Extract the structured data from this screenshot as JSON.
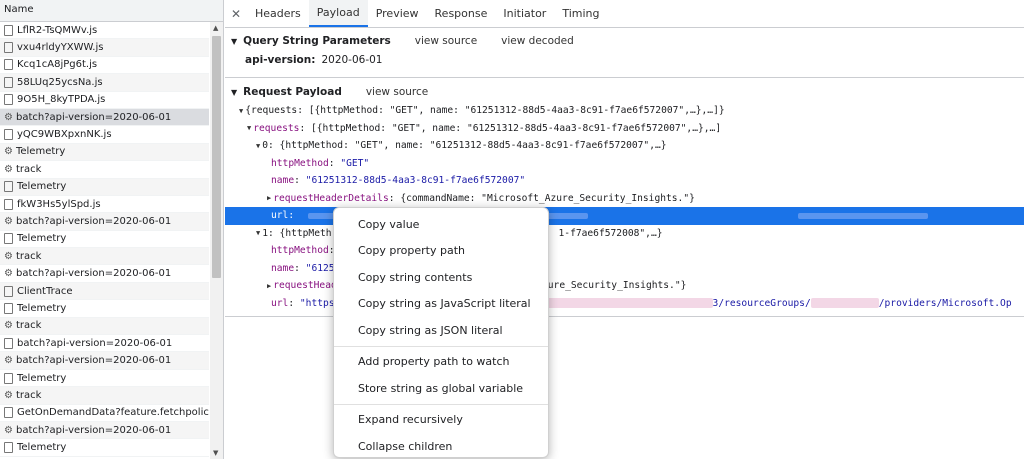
{
  "left": {
    "column_header": "Name",
    "rows": [
      {
        "icon": "file",
        "label": "LflR2-TsQMWv.js",
        "selected": false
      },
      {
        "icon": "file",
        "label": "vxu4rldyYXWW.js",
        "selected": false
      },
      {
        "icon": "file",
        "label": "Kcq1cA8jPg6t.js",
        "selected": false
      },
      {
        "icon": "file",
        "label": "58LUq25ycsNa.js",
        "selected": false
      },
      {
        "icon": "file",
        "label": "9O5H_8kyTPDA.js",
        "selected": false
      },
      {
        "icon": "gear",
        "label": "batch?api-version=2020-06-01",
        "selected": true
      },
      {
        "icon": "file",
        "label": "yQC9WBXpxnNK.js",
        "selected": false
      },
      {
        "icon": "gear",
        "label": "Telemetry",
        "selected": false
      },
      {
        "icon": "gear",
        "label": "track",
        "selected": false
      },
      {
        "icon": "file",
        "label": "Telemetry",
        "selected": false
      },
      {
        "icon": "file",
        "label": "fkW3Hs5ylSpd.js",
        "selected": false
      },
      {
        "icon": "gear",
        "label": "batch?api-version=2020-06-01",
        "selected": false
      },
      {
        "icon": "file",
        "label": "Telemetry",
        "selected": false
      },
      {
        "icon": "gear",
        "label": "track",
        "selected": false
      },
      {
        "icon": "gear",
        "label": "batch?api-version=2020-06-01",
        "selected": false
      },
      {
        "icon": "file",
        "label": "ClientTrace",
        "selected": false
      },
      {
        "icon": "file",
        "label": "Telemetry",
        "selected": false
      },
      {
        "icon": "gear",
        "label": "track",
        "selected": false
      },
      {
        "icon": "file",
        "label": "batch?api-version=2020-06-01",
        "selected": false
      },
      {
        "icon": "gear",
        "label": "batch?api-version=2020-06-01",
        "selected": false
      },
      {
        "icon": "file",
        "label": "Telemetry",
        "selected": false
      },
      {
        "icon": "gear",
        "label": "track",
        "selected": false
      },
      {
        "icon": "file",
        "label": "GetOnDemandData?feature.fetchpolicyforre",
        "selected": false
      },
      {
        "icon": "gear",
        "label": "batch?api-version=2020-06-01",
        "selected": false
      },
      {
        "icon": "file",
        "label": "Telemetry",
        "selected": false
      }
    ]
  },
  "tabs": {
    "close_symbol": "✕",
    "items": [
      "Headers",
      "Payload",
      "Preview",
      "Response",
      "Initiator",
      "Timing"
    ],
    "active": "Payload"
  },
  "query": {
    "title": "Query String Parameters",
    "view_source": "view source",
    "view_decoded": "view decoded",
    "param_key": "api-version:",
    "param_value": "2020-06-01"
  },
  "payload": {
    "title": "Request Payload",
    "view_source": "view source",
    "lines": {
      "l1": "{requests: [{httpMethod: \"GET\", name: \"61251312-88d5-4aa3-8c91-f7ae6f572007\",…},…]}",
      "l2_key": "requests",
      "l2_val": "[{httpMethod: \"GET\", name: \"61251312-88d5-4aa3-8c91-f7ae6f572007\",…},…]",
      "l3": "0: {httpMethod: \"GET\", name: \"61251312-88d5-4aa3-8c91-f7ae6f572007\",…}",
      "l4_key": "httpMethod",
      "l4_val": "\"GET\"",
      "l5_key": "name",
      "l5_val": "\"61251312-88d5-4aa3-8c91-f7ae6f572007\"",
      "l6_key": "requestHeaderDetails",
      "l6_val": "{commandName: \"Microsoft_Azure_Security_Insights.\"}",
      "l7_key": "url",
      "l8_a": "1: {httpMeth",
      "l8_b": "1-f7ae6f572008\",…}",
      "l9_key": "httpMethod",
      "l10_key": "name",
      "l10_val": "\"61251",
      "l11_key": "requestHead",
      "l11_val": "ure_Security_Insights.\"}",
      "l12_key": "url",
      "l12_val_a": "\"https",
      "l12_val_b": "3/resourceGroups/",
      "l12_val_c": "/providers/Microsoft.Op"
    }
  },
  "context_menu": {
    "group1": [
      "Copy value",
      "Copy property path",
      "Copy string contents",
      "Copy string as JavaScript literal",
      "Copy string as JSON literal"
    ],
    "group2": [
      "Add property path to watch",
      "Store string as global variable"
    ],
    "group3": [
      "Expand recursively",
      "Collapse children"
    ]
  }
}
